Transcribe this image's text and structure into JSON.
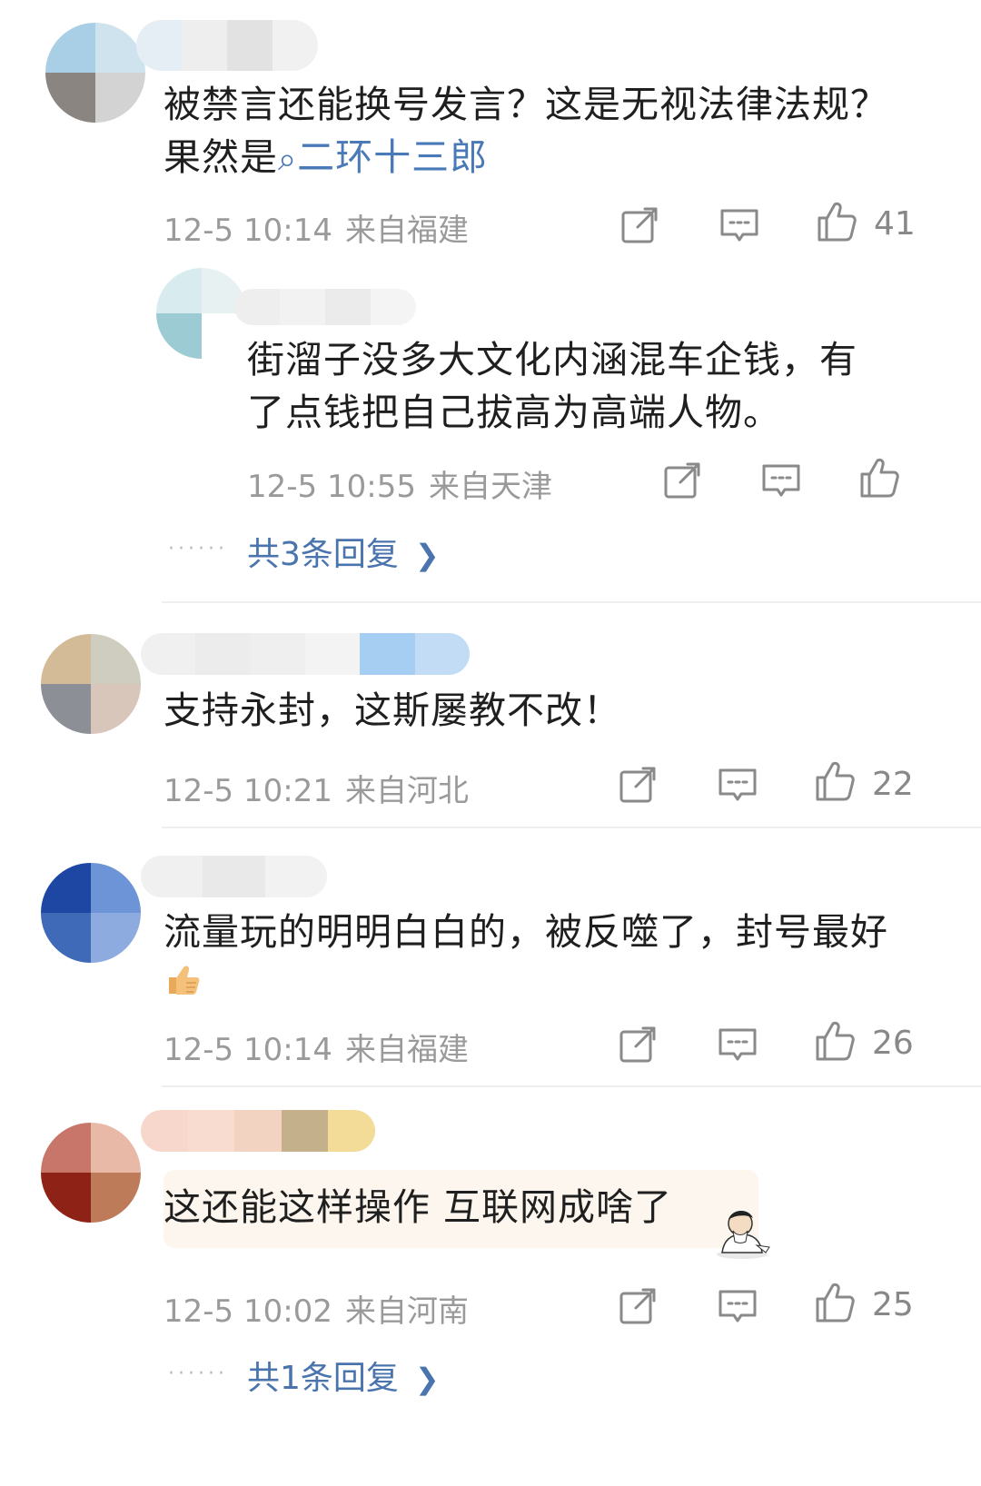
{
  "comments": [
    {
      "text": "被禁言还能换号发言？这是无视法律法规？",
      "text_line2": "果然是",
      "mention": "二环十三郎",
      "time": "12-5 10:14",
      "location": "来自福建",
      "likes": "41",
      "reply": {
        "text_line1": "街溜子没多大文化内涵混车企钱，有",
        "text_line2": "了点钱把自己拔高为高端人物。",
        "time": "12-5 10:55",
        "location": "来自天津"
      },
      "replies_link": "共3条回复"
    },
    {
      "text": "支持永封，这斯屡教不改！",
      "time": "12-5 10:21",
      "location": "来自河北",
      "likes": "22"
    },
    {
      "text": "流量玩的明明白白的，被反噬了，封号最好",
      "time": "12-5 10:14",
      "location": "来自福建",
      "likes": "26"
    },
    {
      "text": "这还能这样操作 互联网成啥了",
      "time": "12-5 10:02",
      "location": "来自河南",
      "likes": "25",
      "replies_link": "共1条回复"
    }
  ],
  "icons": {
    "share": "share-icon",
    "comment": "comment-icon",
    "like": "thumbs-up-icon",
    "search": "search-icon",
    "chevron": "chevron-right-icon",
    "emoji_thumb": "thumbs-up-emoji-icon",
    "emoji_sticker": "old-man-sticker-icon"
  },
  "colors": {
    "mention": "#4a79b8",
    "replies_link": "#4a74ad",
    "meta": "#9a9a9a",
    "text": "#1f1f1f"
  }
}
